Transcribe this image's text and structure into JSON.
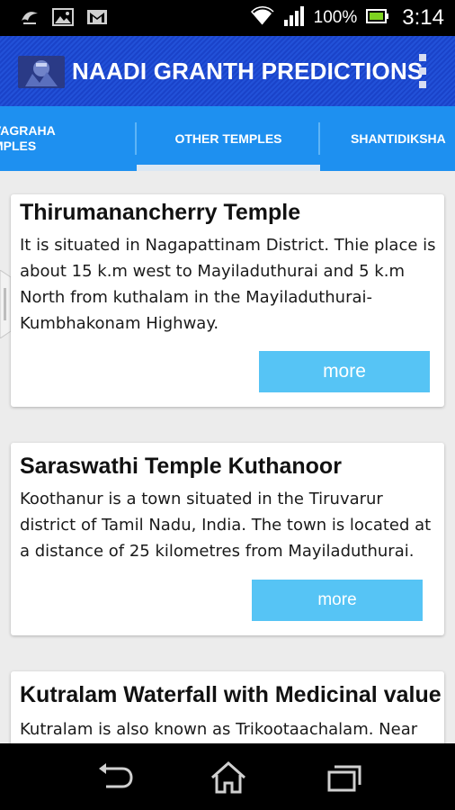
{
  "status_bar": {
    "battery_percent": "100%",
    "time": "3:14",
    "icons": [
      "notification-bird-icon",
      "gallery-icon",
      "gmail-icon",
      "wifi-icon",
      "signal-icon",
      "battery-icon"
    ]
  },
  "action_bar": {
    "title": "NAADI GRANTH PREDICTIONS",
    "logo": "app-logo",
    "overflow": "overflow-menu-icon"
  },
  "tabs": [
    {
      "label_line1": "VAGRAHA",
      "label_line2": "MPLES"
    },
    {
      "label": "OTHER TEMPLES",
      "selected": true
    },
    {
      "label": "SHANTIDIKSHA"
    }
  ],
  "cards": [
    {
      "title": "Thirumanancherry Temple",
      "body": "It is situated in Nagapattinam District. Thie place is about 15 k.m west to Mayiladuthurai and 5 k.m North from kuthalam in the Mayiladuthurai- Kumbhakonam Highway.",
      "button": "more"
    },
    {
      "title": "Saraswathi Temple Kuthanoor",
      "body": "Koothanur is a town situated in the Tiruvarur district of Tamil Nadu, India. The town is located at a distance of 25 kilometres from Mayiladuthurai.",
      "button": "more"
    },
    {
      "title": "Kutralam Waterfall with Medicinal value",
      "body": "Kutralam is also known as Trikootaachalam. Near"
    }
  ],
  "colors": {
    "action_bar": "#2251d8",
    "tab_bar": "#1e90f0",
    "button": "#56c4f5",
    "background": "#ececec"
  },
  "nav_bar": {
    "icons": [
      "back-icon",
      "home-icon",
      "recent-apps-icon"
    ]
  }
}
